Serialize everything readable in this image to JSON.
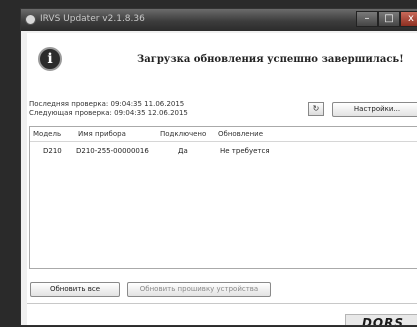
{
  "window": {
    "title": "IRVS Updater v2.1.8.36",
    "minimize_glyph": "–",
    "maximize_glyph": "□",
    "close_glyph": "x"
  },
  "status": {
    "icon": "info-icon",
    "icon_glyph": "i",
    "message": "Загрузка обновления успешно завершилась!"
  },
  "checks": {
    "last": "Последняя проверка: 09:04:35 11.06.2015",
    "next": "Следующая проверка: 09:04:35 12.06.2015"
  },
  "toolbar": {
    "small_button_icon": "sync-icon",
    "small_button_glyph": "↻",
    "settings_label": "Настройки..."
  },
  "table": {
    "columns": [
      "Модель",
      "Имя прибора",
      "Подключено",
      "Обновление"
    ],
    "rows": [
      [
        "D210",
        "D210-255-00000016",
        "Да",
        "Не требуется"
      ]
    ]
  },
  "actions": {
    "update_all": "Обновить все",
    "update_firmware": "Обновить прошивку устройства"
  },
  "brand": {
    "logo_text": "DORS"
  }
}
